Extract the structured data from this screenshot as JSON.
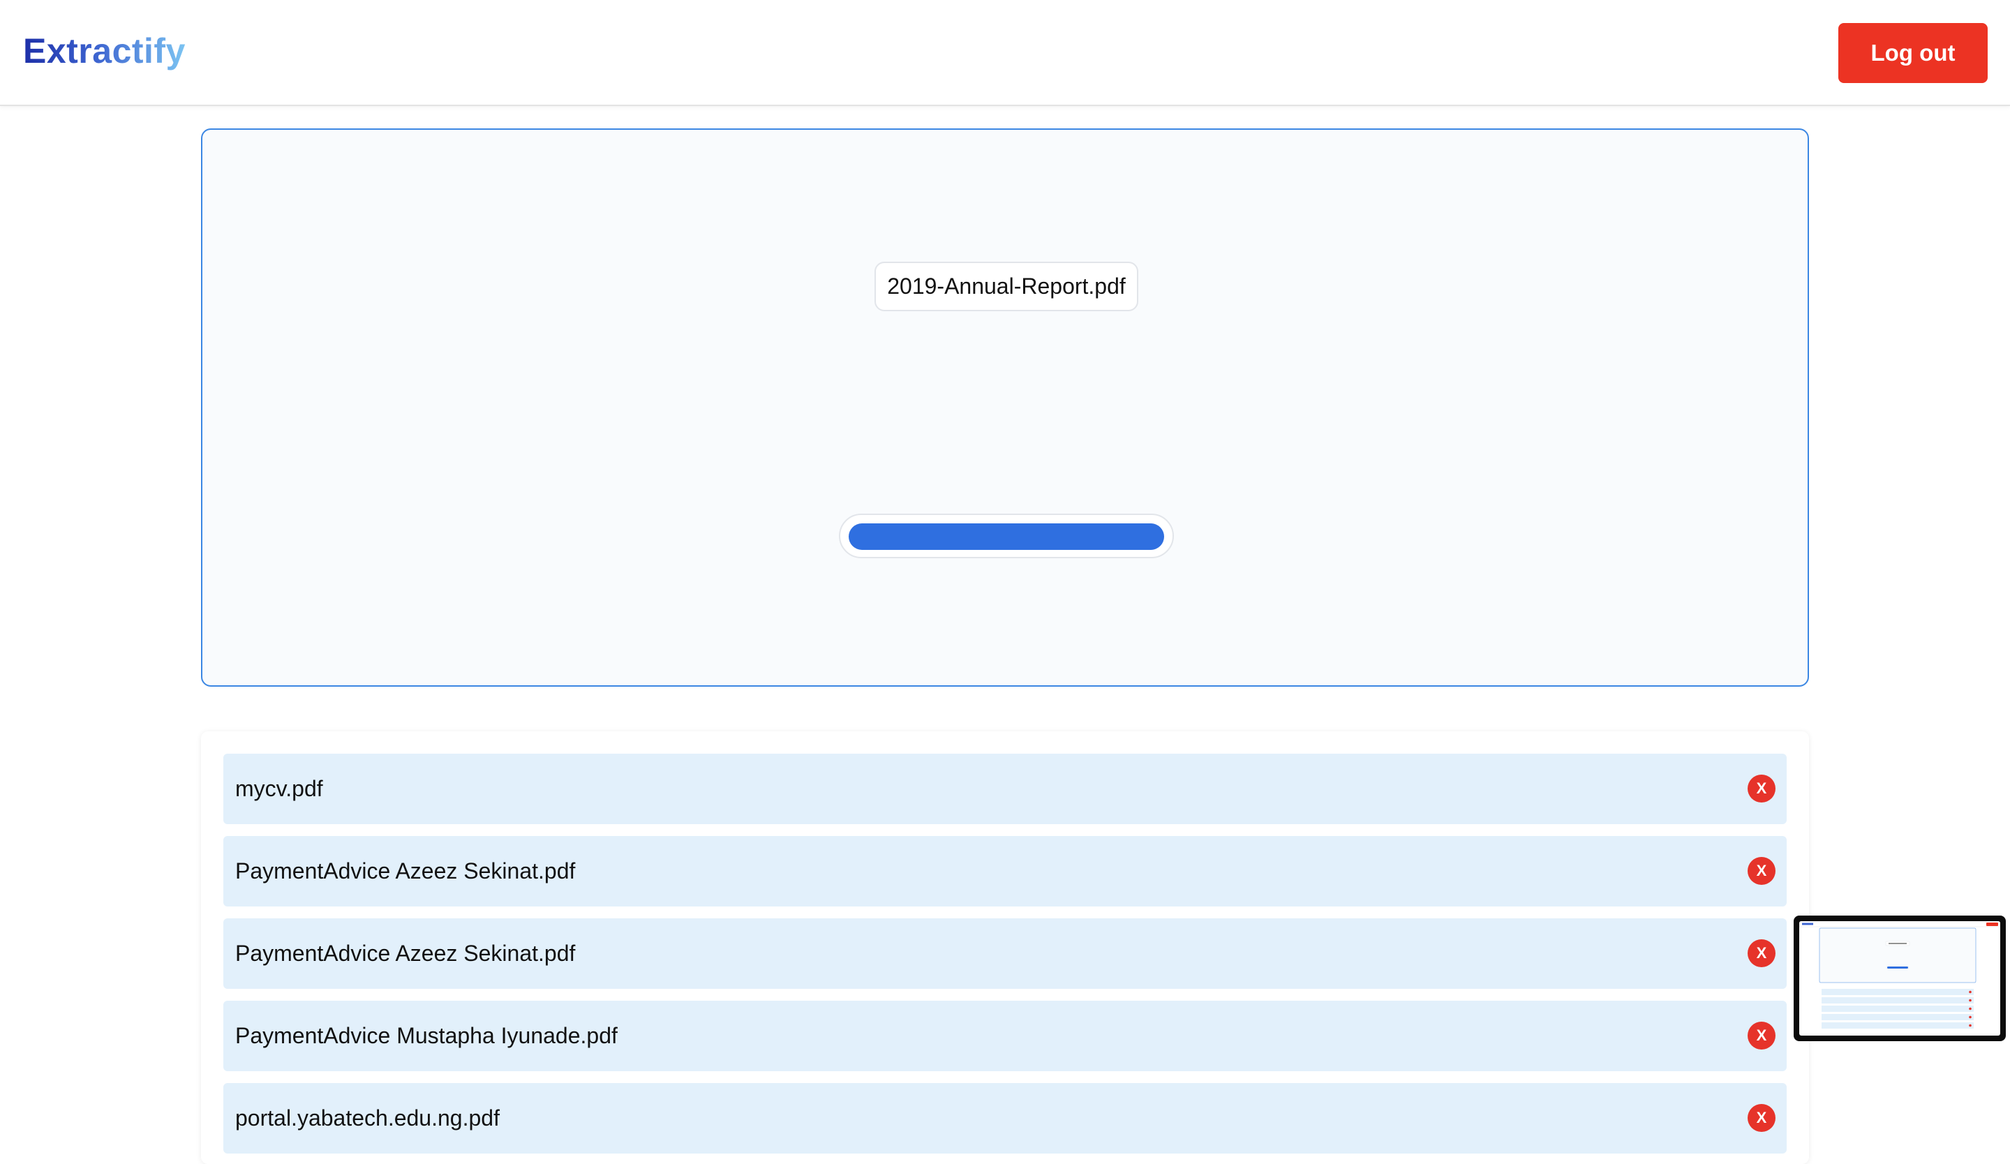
{
  "header": {
    "logo_text": "Extractify",
    "logout_label": "Log out"
  },
  "upload": {
    "file_name": "2019-Annual-Report.pdf",
    "progress": 1.0
  },
  "files": [
    {
      "name": "mycv.pdf",
      "remove_label": "X"
    },
    {
      "name": "PaymentAdvice Azeez Sekinat.pdf",
      "remove_label": "X"
    },
    {
      "name": "PaymentAdvice Azeez Sekinat.pdf",
      "remove_label": "X"
    },
    {
      "name": "PaymentAdvice Mustapha Iyunade.pdf",
      "remove_label": "X"
    },
    {
      "name": "portal.yabatech.edu.ng.pdf",
      "remove_label": "X"
    }
  ],
  "colors": {
    "accent": "#2f6fe0",
    "danger": "#ec3323",
    "row_bg": "#e2f0fb",
    "panel_border": "#3c87e3"
  },
  "icons": {
    "remove": "close-icon"
  }
}
